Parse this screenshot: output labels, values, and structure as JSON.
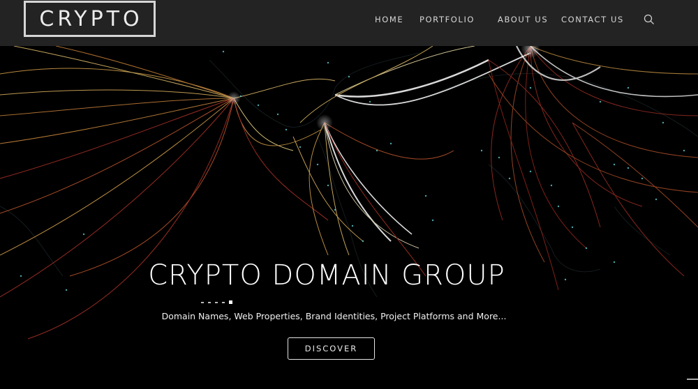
{
  "brand": {
    "logo_text": "CRYPTO"
  },
  "nav": {
    "items": [
      {
        "label": "HOME"
      },
      {
        "label": "PORTFOLIO"
      },
      {
        "label": "ABOUT US"
      },
      {
        "label": "CONTACT US"
      }
    ],
    "search_icon": "search-icon"
  },
  "hero": {
    "title": "CRYPTO DOMAIN GROUP",
    "subtitle": "Domain Names, Web Properties, Brand Identities, Project Platforms and More...",
    "button_label": "DISCOVER",
    "background": "world map with glowing flight-route arcs"
  },
  "colors": {
    "nav_bg": "#232323",
    "hero_bg": "#000000",
    "arc_warm": "#d8a24a",
    "arc_red": "#b2342a",
    "arc_white": "#ffffff",
    "city_dots": "#5fd0d8"
  }
}
